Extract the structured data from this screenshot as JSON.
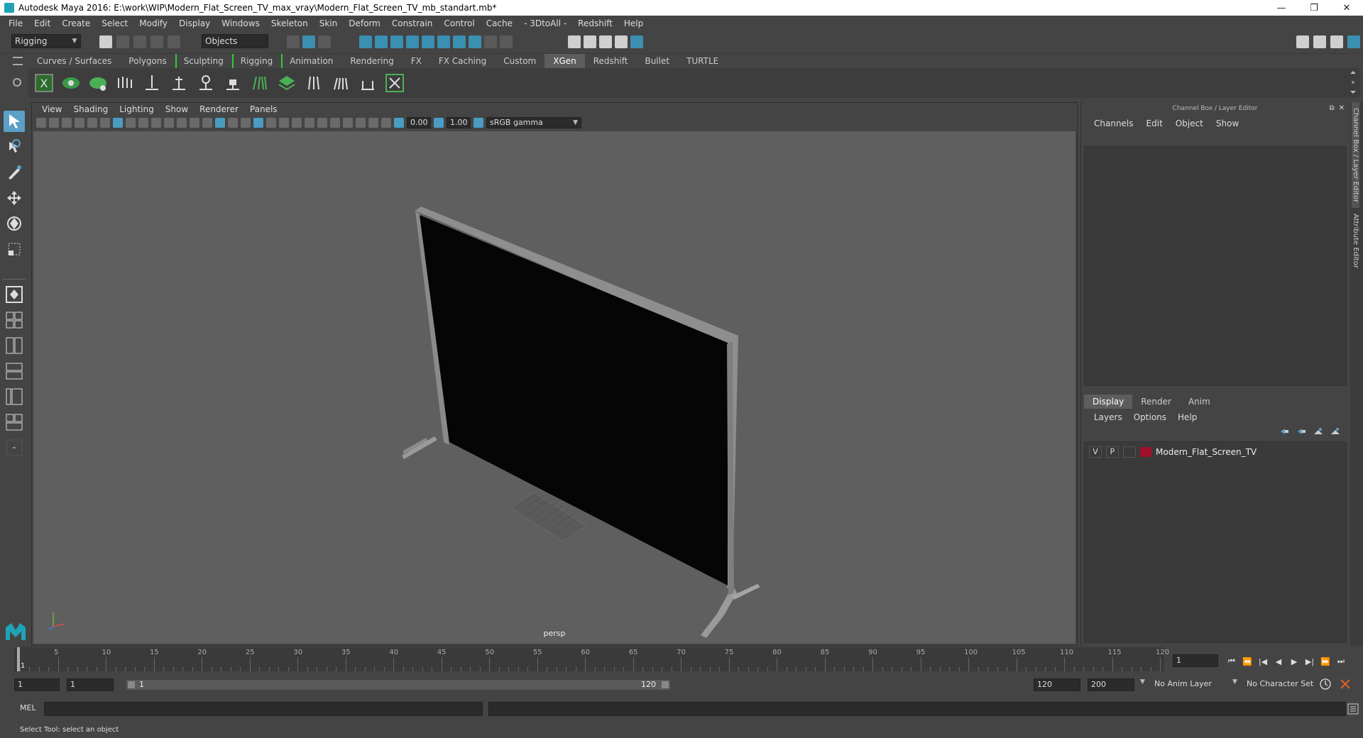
{
  "window": {
    "title": "Autodesk Maya 2016: E:\\work\\WIP\\Modern_Flat_Screen_TV_max_vray\\Modern_Flat_Screen_TV_mb_standart.mb*",
    "minimize": "—",
    "maximize": "❐",
    "close": "✕"
  },
  "menubar": [
    "File",
    "Edit",
    "Create",
    "Select",
    "Modify",
    "Display",
    "Windows",
    "Skeleton",
    "Skin",
    "Deform",
    "Constrain",
    "Control",
    "Cache",
    "- 3DtoAll -",
    "Redshift",
    "Help"
  ],
  "status": {
    "menuset": "Rigging",
    "selection_mode": "Objects"
  },
  "shelf_tabs": [
    {
      "label": "Curves / Surfaces"
    },
    {
      "label": "Polygons"
    },
    {
      "label": "Sculpting"
    },
    {
      "label": "Rigging"
    },
    {
      "label": "Animation"
    },
    {
      "label": "Rendering"
    },
    {
      "label": "FX"
    },
    {
      "label": "FX Caching"
    },
    {
      "label": "Custom"
    },
    {
      "label": "XGen",
      "active": true
    },
    {
      "label": "Redshift"
    },
    {
      "label": "Bullet"
    },
    {
      "label": "TURTLE"
    }
  ],
  "viewport": {
    "menu": [
      "View",
      "Shading",
      "Lighting",
      "Show",
      "Renderer",
      "Panels"
    ],
    "exposure": "0.00",
    "gamma": "1.00",
    "color_space": "sRGB gamma",
    "camera_label": "persp"
  },
  "channel_box": {
    "title": "Channel Box / Layer Editor",
    "menu": [
      "Channels",
      "Edit",
      "Object",
      "Show"
    ],
    "layer_tabs": [
      {
        "label": "Display",
        "active": true
      },
      {
        "label": "Render"
      },
      {
        "label": "Anim"
      }
    ],
    "layer_menu": [
      "Layers",
      "Options",
      "Help"
    ],
    "layers": [
      {
        "visible": "V",
        "playback": "P",
        "name": "Modern_Flat_Screen_TV",
        "color": "#a0102a"
      }
    ]
  },
  "side_tabs": [
    "Channel Box / Layer Editor",
    "Attribute Editor"
  ],
  "timeline": {
    "ticks": [
      5,
      10,
      15,
      20,
      25,
      30,
      35,
      40,
      45,
      50,
      55,
      60,
      65,
      70,
      75,
      80,
      85,
      90,
      95,
      100,
      105,
      110,
      115,
      120
    ],
    "current_frame_marker": "1",
    "current_frame_field": "1"
  },
  "range": {
    "start_field": "1",
    "playback_start": "1",
    "slider_start": "1",
    "slider_end": "120",
    "playback_end": "120",
    "end_field": "200",
    "anim_layer": "No Anim Layer",
    "character_set": "No Character Set"
  },
  "mel": {
    "label": "MEL"
  },
  "helpline": "Select Tool: select an object"
}
